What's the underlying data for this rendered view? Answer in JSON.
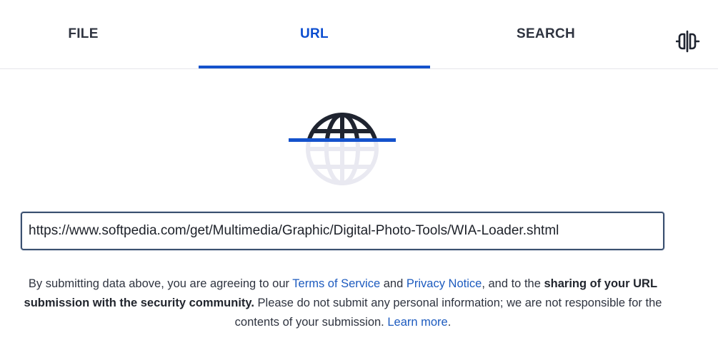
{
  "tabs": {
    "file_label": "FILE",
    "url_label": "URL",
    "search_label": "SEARCH",
    "active": "URL",
    "extra_icon": "api-icon"
  },
  "hero": {
    "icon": "globe-icon",
    "accent_color": "#1452cc"
  },
  "url_input": {
    "value": "https://www.softpedia.com/get/Multimedia/Graphic/Digital-Photo-Tools/WIA-Loader.shtml"
  },
  "notice": {
    "prefix": "By submitting data above, you are agreeing to our ",
    "terms_link": "Terms of Service",
    "and": " and ",
    "privacy_link": "Privacy Notice",
    "middle": ", and to the ",
    "bold": "sharing of your URL submission with the security community.",
    "suffix": " Please do not submit any personal information; we are not responsible for the contents of your submission. ",
    "learn_more_link": "Learn more",
    "end": "."
  }
}
